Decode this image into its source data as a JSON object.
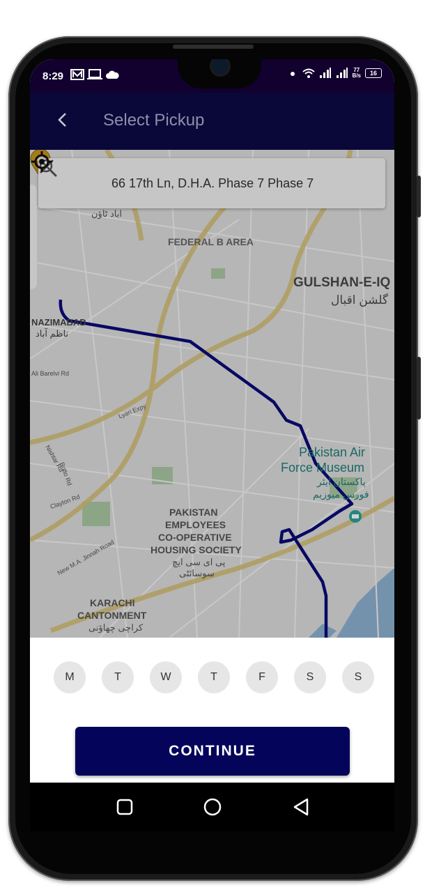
{
  "status_bar": {
    "time": "8:29",
    "net_speed_value": "77",
    "net_speed_unit": "B/s",
    "battery": "16",
    "icons": [
      "gallery-icon",
      "laptop-icon",
      "cloud-icon",
      "dot-icon",
      "wifi-icon",
      "signal-icon",
      "signal-icon",
      "battery-icon"
    ]
  },
  "app_bar": {
    "back_icon": "chevron-left-icon",
    "title": "Select Pickup"
  },
  "search": {
    "value": "66 17th Ln, D.H.A. Phase 7 Phase 7 I",
    "icon": "search-icon",
    "clear_icon": "close-icon"
  },
  "map": {
    "labels": {
      "abad_town_ur": "اباد ٹاؤن",
      "federal_b_area": "FEDERAL B AREA",
      "gulshan": "GULSHAN-E-IQ",
      "gulshan_ur": "گلشن اقبال",
      "nazimabad": "NAZIMABAD",
      "nazimabad_ur": "ناظم آباد",
      "ali_barelvi": "Ali Barelvi Rd",
      "lyari_expy": "Lyari Expy",
      "nishtar": "Nishtar Rd",
      "britto": "Britto Rd",
      "clayton": "Clayton Rd",
      "new_ma_jinnah": "New M.A. Jinnah Road",
      "paf_museum_1": "Pakistan Air",
      "paf_museum_2": "Force Museum",
      "paf_museum_ur_1": "پاکستان ایئر",
      "paf_museum_ur_2": "فورس میوزیم",
      "pechs_1": "PAKISTAN",
      "pechs_2": "EMPLOYEES",
      "pechs_3": "CO-OPERATIVE",
      "pechs_4": "HOUSING SOCIETY",
      "pechs_ur_1": "پی ای سی ایچ",
      "pechs_ur_2": "سوسائٹی",
      "karachi_1": "KARACHI",
      "karachi_2": "CANTONMENT",
      "karachi_ur": "کراچی چھاؤنی"
    },
    "route_color": "#0a0a7a",
    "pin_color": "#c9961e"
  },
  "days": [
    "M",
    "T",
    "W",
    "T",
    "F",
    "S",
    "S"
  ],
  "continue_label": "CONTINUE",
  "nav": {
    "recent": "square-icon",
    "home": "circle-icon",
    "back": "triangle-back-icon"
  },
  "colors": {
    "app_bar": "#0a0838",
    "button": "#04045a",
    "day_bg": "#e6e6e6"
  }
}
